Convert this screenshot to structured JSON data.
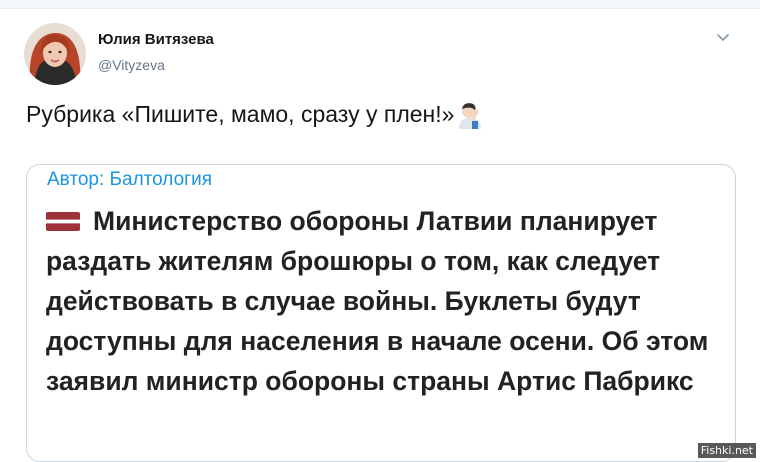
{
  "author": {
    "name": "Юлия Витязева",
    "handle": "@Vityzeva"
  },
  "tweet": {
    "text": "Рубрика «Пишите, мамо, сразу у плен!»",
    "emoji": "man-facepalming-icon"
  },
  "quote": {
    "author": "Автор: Балтология",
    "flag": "latvia-flag-icon",
    "text": "Министерство обороны Латвии планирует раздать жителям брошюры о том, как следует действовать в случае войны. Буклеты будут доступны для населения в начале осени. Об этом заявил министр обороны страны Артис Пабрикс"
  },
  "watermark": "Fishki.net",
  "colors": {
    "link": "#1b95e0",
    "handle": "#657786",
    "border": "#ccd6dd",
    "flag_red": "#9e3039",
    "flag_white": "#ffffff"
  }
}
